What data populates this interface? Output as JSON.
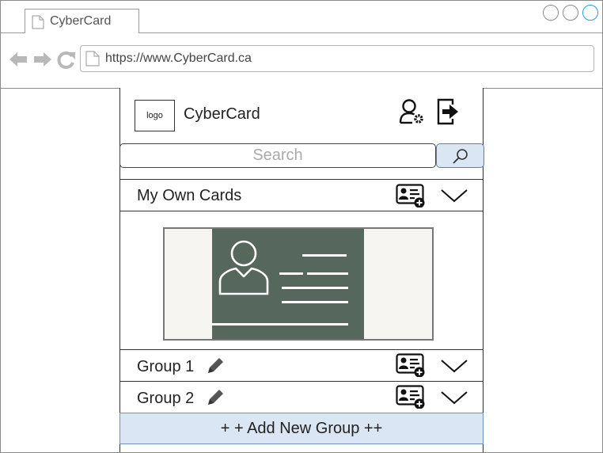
{
  "browser": {
    "tab_title": "CyberCard",
    "url": "https://www.CyberCard.ca"
  },
  "app": {
    "logo_text": "logo",
    "title": "CyberCard",
    "search": {
      "placeholder": "Search"
    },
    "sections": [
      {
        "label": "My Own Cards"
      },
      {
        "label": "Group 1"
      },
      {
        "label": "Group 2"
      }
    ],
    "add_group_label": "+ + Add New Group ++"
  },
  "colors": {
    "accent_fill": "#dbe6f5",
    "accent_border": "#6f8fbe",
    "card_fill": "#56675d"
  }
}
